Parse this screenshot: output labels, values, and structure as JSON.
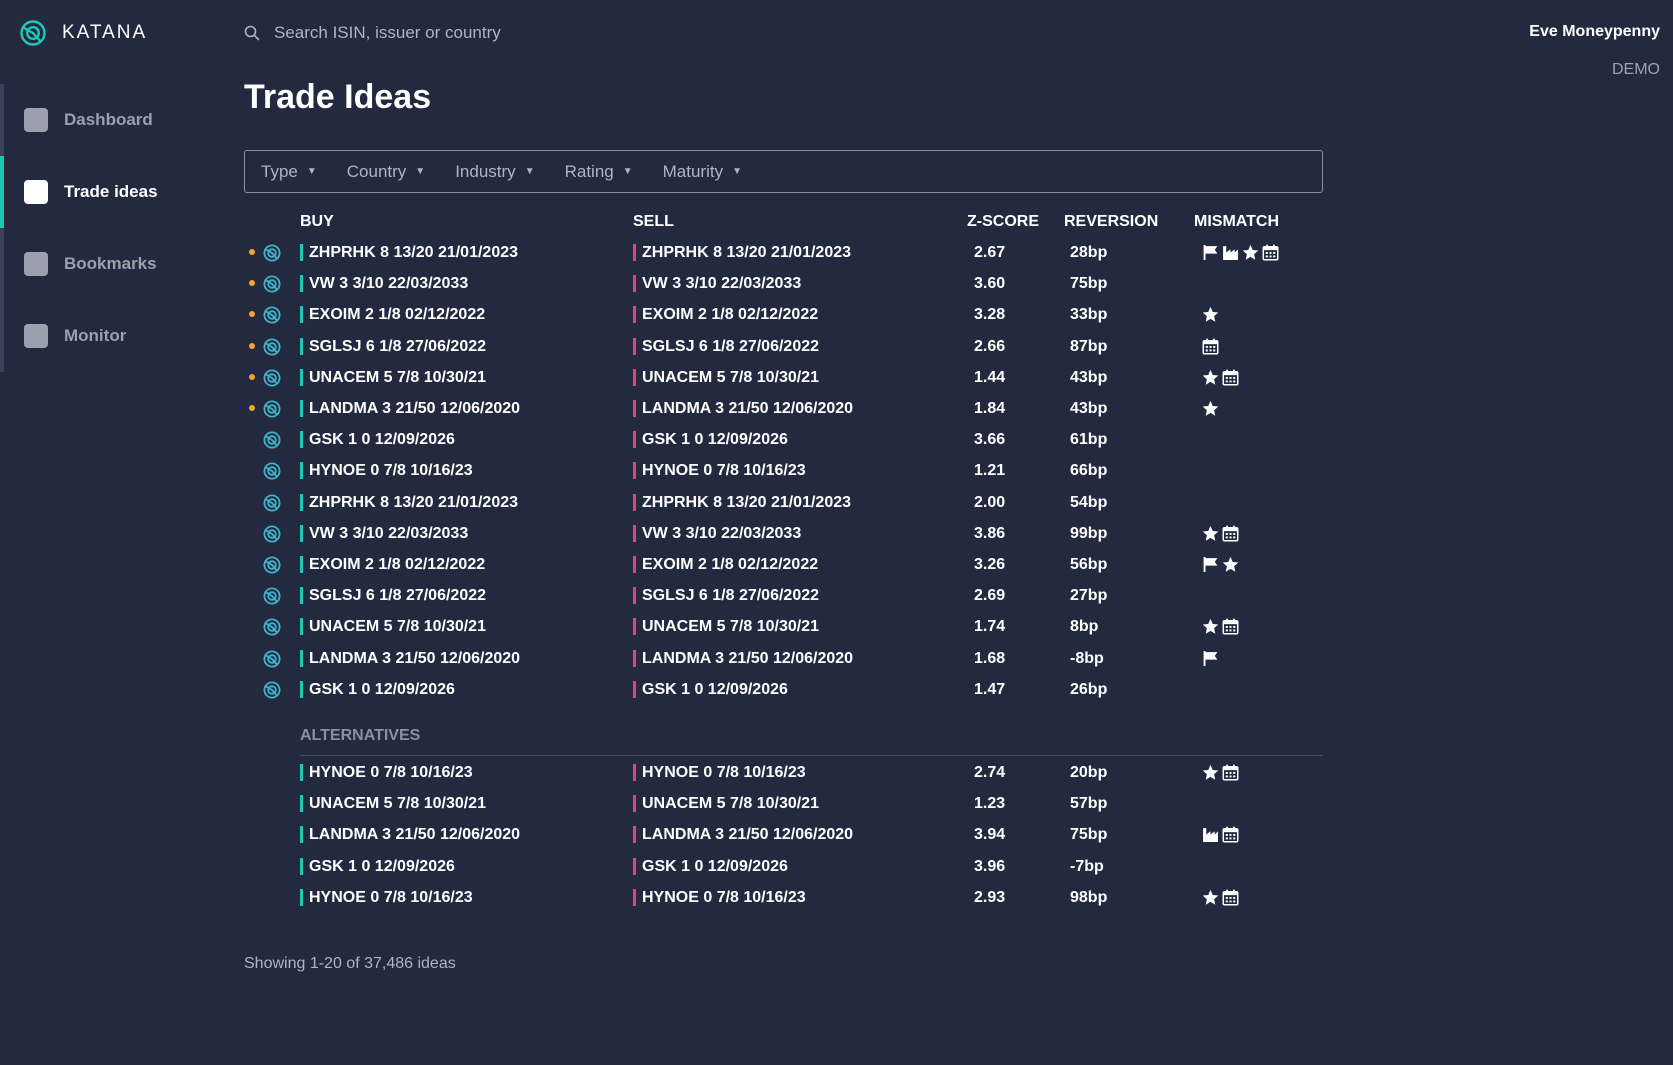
{
  "app": {
    "name": "KATANA"
  },
  "search": {
    "placeholder": "Search ISIN, issuer or country"
  },
  "user": {
    "name": "Eve Moneypenny",
    "environment": "DEMO"
  },
  "nav": [
    {
      "label": "Dashboard",
      "active": false
    },
    {
      "label": "Trade ideas",
      "active": true
    },
    {
      "label": "Bookmarks",
      "active": false
    },
    {
      "label": "Monitor",
      "active": false
    }
  ],
  "page": {
    "title": "Trade Ideas"
  },
  "filters": [
    "Type",
    "Country",
    "Industry",
    "Rating",
    "Maturity"
  ],
  "table": {
    "headers": {
      "buy": "BUY",
      "sell": "SELL",
      "zscore": "Z-SCORE",
      "reversion": "REVERSION",
      "mismatch": "MISMATCH"
    },
    "rows": [
      {
        "buy": "ZHPRHK 8 13/20 21/01/2023",
        "sell": "ZHPRHK 8 13/20 21/01/2023",
        "z": "2.67",
        "rev": "28bp",
        "mismatch": [
          "flag",
          "industry",
          "star",
          "calendar"
        ],
        "new": true
      },
      {
        "buy": "VW 3 3/10 22/03/2033",
        "sell": "VW 3 3/10 22/03/2033",
        "z": "3.60",
        "rev": "75bp",
        "mismatch": [],
        "new": true
      },
      {
        "buy": "EXOIM 2 1/8 02/12/2022",
        "sell": "EXOIM 2 1/8 02/12/2022",
        "z": "3.28",
        "rev": "33bp",
        "mismatch": [
          "star"
        ],
        "new": true
      },
      {
        "buy": "SGLSJ 6 1/8 27/06/2022",
        "sell": "SGLSJ 6 1/8 27/06/2022",
        "z": "2.66",
        "rev": "87bp",
        "mismatch": [
          "calendar"
        ],
        "new": true
      },
      {
        "buy": "UNACEM 5 7/8 10/30/21",
        "sell": "UNACEM 5 7/8 10/30/21",
        "z": "1.44",
        "rev": "43bp",
        "mismatch": [
          "star",
          "calendar"
        ],
        "new": true
      },
      {
        "buy": "LANDMA 3 21/50 12/06/2020",
        "sell": "LANDMA 3 21/50 12/06/2020",
        "z": "1.84",
        "rev": "43bp",
        "mismatch": [
          "star"
        ],
        "new": true
      },
      {
        "buy": "GSK 1 0 12/09/2026",
        "sell": "GSK 1 0 12/09/2026",
        "z": "3.66",
        "rev": "61bp",
        "mismatch": [],
        "new": false
      },
      {
        "buy": "HYNOE 0 7/8 10/16/23",
        "sell": "HYNOE 0 7/8 10/16/23",
        "z": "1.21",
        "rev": "66bp",
        "mismatch": [],
        "new": false
      },
      {
        "buy": "ZHPRHK 8 13/20 21/01/2023",
        "sell": "ZHPRHK 8 13/20 21/01/2023",
        "z": "2.00",
        "rev": "54bp",
        "mismatch": [],
        "new": false
      },
      {
        "buy": "VW 3 3/10 22/03/2033",
        "sell": "VW 3 3/10 22/03/2033",
        "z": "3.86",
        "rev": "99bp",
        "mismatch": [
          "star",
          "calendar"
        ],
        "new": false
      },
      {
        "buy": "EXOIM 2 1/8 02/12/2022",
        "sell": "EXOIM 2 1/8 02/12/2022",
        "z": "3.26",
        "rev": "56bp",
        "mismatch": [
          "flag",
          "star"
        ],
        "new": false
      },
      {
        "buy": "SGLSJ 6 1/8 27/06/2022",
        "sell": "SGLSJ 6 1/8 27/06/2022",
        "z": "2.69",
        "rev": "27bp",
        "mismatch": [],
        "new": false
      },
      {
        "buy": "UNACEM 5 7/8 10/30/21",
        "sell": "UNACEM 5 7/8 10/30/21",
        "z": "1.74",
        "rev": "8bp",
        "mismatch": [
          "star",
          "calendar"
        ],
        "new": false
      },
      {
        "buy": "LANDMA 3 21/50 12/06/2020",
        "sell": "LANDMA 3 21/50 12/06/2020",
        "z": "1.68",
        "rev": "-8bp",
        "mismatch": [
          "flag"
        ],
        "new": false
      },
      {
        "buy": "GSK 1 0 12/09/2026",
        "sell": "GSK 1 0 12/09/2026",
        "z": "1.47",
        "rev": "26bp",
        "mismatch": [],
        "new": false
      }
    ]
  },
  "alternatives": {
    "title": "ALTERNATIVES",
    "rows": [
      {
        "buy": "HYNOE 0 7/8 10/16/23",
        "sell": "HYNOE 0 7/8 10/16/23",
        "z": "2.74",
        "rev": "20bp",
        "mismatch": [
          "star",
          "calendar"
        ]
      },
      {
        "buy": "UNACEM 5 7/8 10/30/21",
        "sell": "UNACEM 5 7/8 10/30/21",
        "z": "1.23",
        "rev": "57bp",
        "mismatch": []
      },
      {
        "buy": "LANDMA 3 21/50 12/06/2020",
        "sell": "LANDMA 3 21/50 12/06/2020",
        "z": "3.94",
        "rev": "75bp",
        "mismatch": [
          "industry",
          "calendar"
        ]
      },
      {
        "buy": "GSK 1 0 12/09/2026",
        "sell": "GSK 1 0 12/09/2026",
        "z": "3.96",
        "rev": "-7bp",
        "mismatch": []
      },
      {
        "buy": "HYNOE 0 7/8 10/16/23",
        "sell": "HYNOE 0 7/8 10/16/23",
        "z": "2.93",
        "rev": "98bp",
        "mismatch": [
          "star",
          "calendar"
        ]
      }
    ]
  },
  "footer": {
    "summary": "Showing 1-20 of 37,486 ideas"
  },
  "colors": {
    "background": "#232a40",
    "accent": "#1fc7b5",
    "buy": "#1fc7b5",
    "sell": "#e0457b",
    "new_dot": "#f0a62b"
  }
}
